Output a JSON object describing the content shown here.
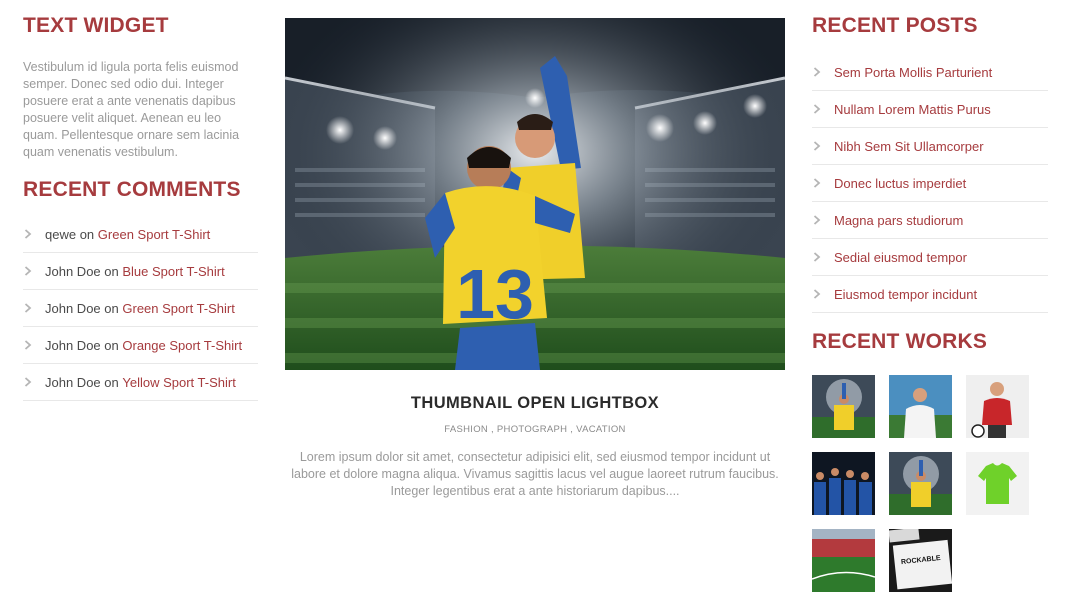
{
  "text_widget": {
    "title": "TEXT WIDGET",
    "body": "Vestibulum id ligula porta felis euismod semper. Donec sed odio dui. Integer posuere erat a ante venenatis dapibus posuere velit aliquet. Aenean eu leo quam. Pellentesque ornare sem lacinia quam venenatis vestibulum."
  },
  "recent_comments": {
    "title": "RECENT COMMENTS",
    "items": [
      {
        "author": "qewe",
        "on": "on",
        "link": "Green Sport T-Shirt"
      },
      {
        "author": "John Doe",
        "on": "on",
        "link": "Blue Sport T-Shirt"
      },
      {
        "author": "John Doe",
        "on": "on",
        "link": "Green Sport T-Shirt"
      },
      {
        "author": "John Doe",
        "on": "on",
        "link": "Orange Sport T-Shirt"
      },
      {
        "author": "John Doe",
        "on": "on",
        "link": "Yellow Sport T-Shirt"
      }
    ]
  },
  "post": {
    "title": "THUMBNAIL OPEN LIGHTBOX",
    "tags": [
      "FASHION",
      "PHOTOGRAPH",
      "VACATION"
    ],
    "tag_separator": " , ",
    "excerpt": "Lorem ipsum dolor sit amet, consectetur adipisici elit, sed eiusmod tempor incidunt ut labore et dolore magna aliqua. Vivamus sagittis lacus vel augue laoreet rutrum faucibus. Integer legentibus erat a ante historiarum dapibus....",
    "image_icon": "football-players-celebrating-image",
    "jersey_number": "13"
  },
  "recent_posts": {
    "title": "RECENT POSTS",
    "items": [
      "Sem Porta Mollis Parturient",
      "Nullam Lorem Mattis Purus",
      "Nibh Sem Sit Ullamcorper",
      "Donec luctus imperdiet",
      "Magna pars studiorum",
      "Sedial eiusmod tempor",
      "Eiusmod tempor incidunt"
    ]
  },
  "recent_works": {
    "title": "RECENT WORKS",
    "thumbnails": [
      "players-celebrating-thumb",
      "player-white-shirt-thumb",
      "player-red-shirt-ball-thumb",
      "team-blue-lineup-thumb",
      "players-celebrating-thumb-2",
      "green-tshirt-thumb",
      "stadium-pitch-thumb",
      "rockable-mockup-thumb"
    ],
    "rockable_text": "ROCKABLE"
  },
  "colors": {
    "accent": "#a63b3e",
    "body_text": "#9a9a9a",
    "chevron": "#b5b5b5"
  }
}
